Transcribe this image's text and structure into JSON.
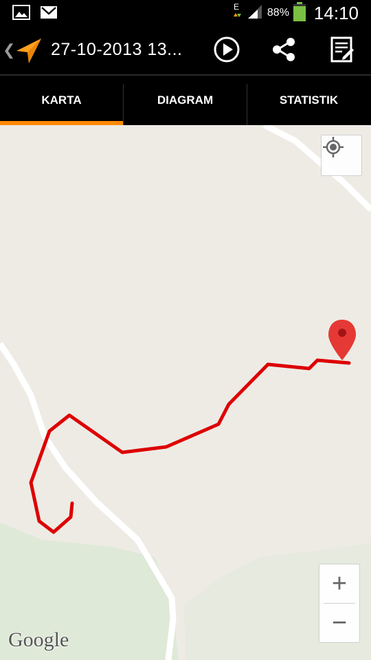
{
  "status_bar": {
    "network_type": "E",
    "battery_percent": "88%",
    "battery_level": 0.88,
    "time": "14:10",
    "notification_icons": [
      "gallery-icon",
      "gmail-icon"
    ]
  },
  "action_bar": {
    "back_icon": "chevron-left-icon",
    "app_icon": "navigation-arrow-icon",
    "title": "27-10-2013 13...",
    "actions": [
      "play-icon",
      "share-icon",
      "edit-note-icon"
    ]
  },
  "tabs": [
    {
      "label": "KARTA",
      "selected": true
    },
    {
      "label": "DIAGRAM",
      "selected": false
    },
    {
      "label": "STATISTIK",
      "selected": false
    }
  ],
  "map": {
    "attribution": "Google",
    "controls": {
      "zoom_in": "+",
      "zoom_out": "−",
      "my_location": "crosshair-icon"
    },
    "track_color": "#dd0000",
    "marker_color": "#e53935",
    "accent_color": "#ff8a00"
  }
}
